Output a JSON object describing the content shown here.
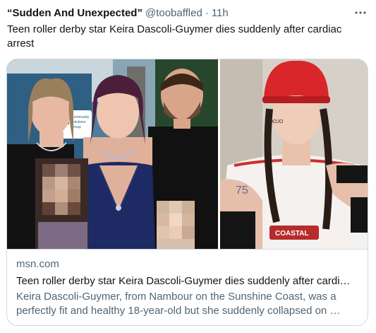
{
  "tweet": {
    "display_name": "“Sudden And Unexpected”",
    "handle": "@toobaffled",
    "separator": "·",
    "time": "11h",
    "more_icon": "more-horizontal-icon",
    "text": "Teen roller derby star Keira Dascoli-Guymer dies suddenly after cardiac arrest"
  },
  "card": {
    "domain": "msn.com",
    "title": "Teen roller derby star Keira Dascoli-Guymer dies suddenly after cardi…",
    "description": "Keira Dascoli-Guymer, from Nambour on the Sunshine Coast, was a perfectly fit and healthy 18-year-old but she suddenly collapsed on …",
    "left_photo": {
      "sign_text": [
        "Community",
        "Solutions",
        "Group"
      ]
    },
    "right_photo": {
      "helmet_text": "DOJO",
      "arm_text": "75",
      "jersey_text": "COASTAL"
    }
  },
  "colors": {
    "text_primary": "#0f1419",
    "text_secondary": "#536471",
    "border": "#cfd9de",
    "helmet_red": "#d8262b"
  }
}
